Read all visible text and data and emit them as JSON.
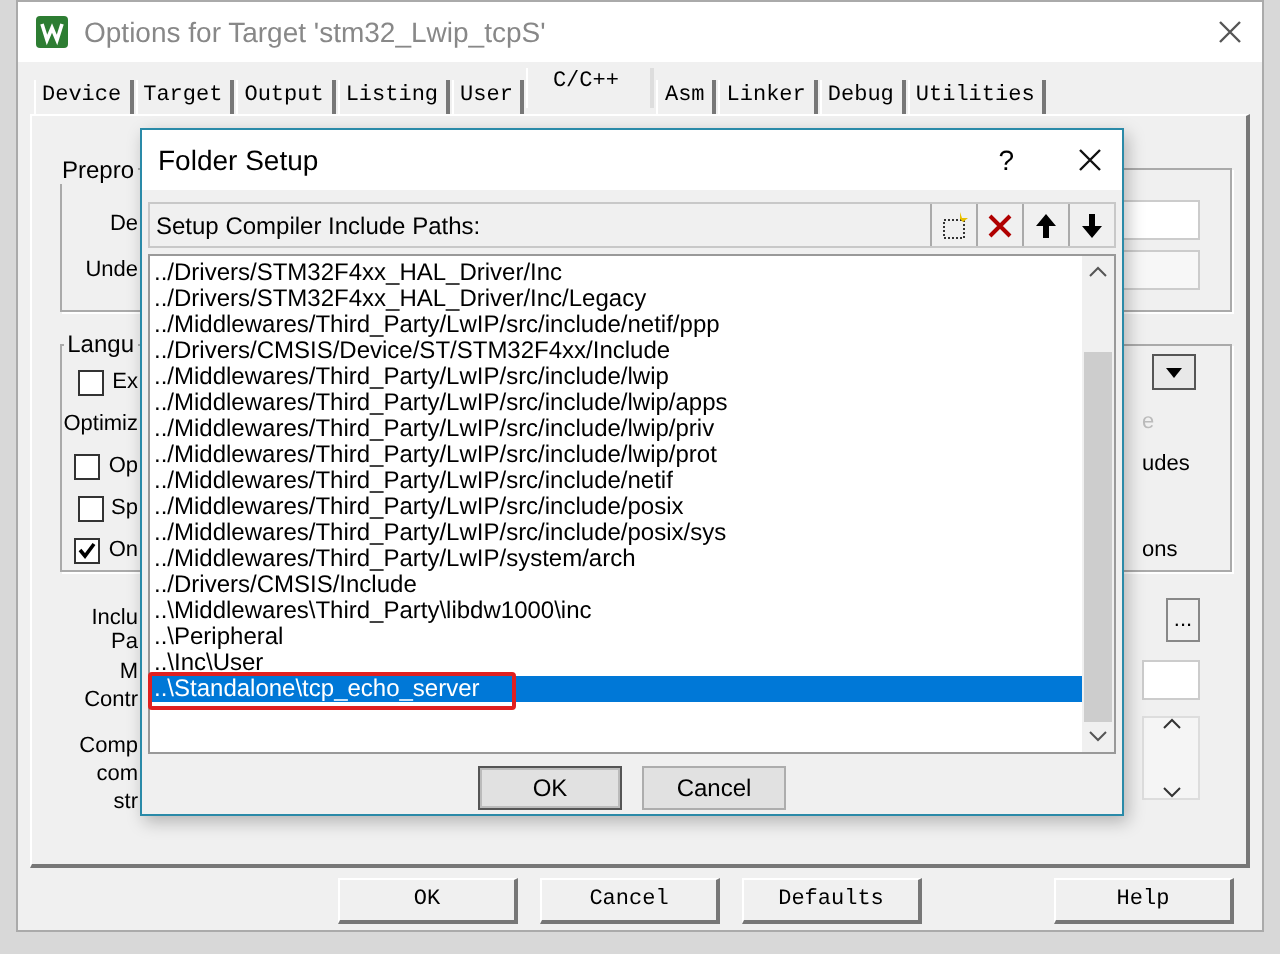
{
  "window": {
    "title": "Options for Target 'stm32_Lwip_tcpS'"
  },
  "tabs": [
    {
      "label": "Device",
      "selected": false
    },
    {
      "label": "Target",
      "selected": false
    },
    {
      "label": "Output",
      "selected": false
    },
    {
      "label": "Listing",
      "selected": false
    },
    {
      "label": "User",
      "selected": false
    },
    {
      "label": "C/C++",
      "selected": true
    },
    {
      "label": "Asm",
      "selected": false
    },
    {
      "label": "Linker",
      "selected": false
    },
    {
      "label": "Debug",
      "selected": false
    },
    {
      "label": "Utilities",
      "selected": false
    }
  ],
  "behind": [
    {
      "kind": "group",
      "text": "Prepro"
    },
    {
      "kind": "label",
      "text": "De"
    },
    {
      "kind": "label",
      "text": "Unde"
    },
    {
      "kind": "group",
      "text": "Langu"
    },
    {
      "kind": "checkbox",
      "text": "Ex",
      "checked": false
    },
    {
      "kind": "label",
      "text": "Optimiz"
    },
    {
      "kind": "checkbox",
      "text": "Op",
      "checked": false
    },
    {
      "kind": "checkbox",
      "text": "Sp",
      "checked": false
    },
    {
      "kind": "checkbox",
      "text": "On",
      "checked": true
    },
    {
      "kind": "label",
      "text": "Inclu"
    },
    {
      "kind": "label",
      "text": "Pa"
    },
    {
      "kind": "label",
      "text": "M"
    },
    {
      "kind": "label",
      "text": "Contr"
    },
    {
      "kind": "label",
      "text": "Comp"
    },
    {
      "kind": "label",
      "text": "com"
    },
    {
      "kind": "label",
      "text": "str"
    },
    {
      "kind": "label",
      "text": "e"
    },
    {
      "kind": "label",
      "text": "udes"
    },
    {
      "kind": "label",
      "text": "ons"
    },
    {
      "kind": "button",
      "text": "..."
    }
  ],
  "buttons": [
    "OK",
    "Cancel",
    "Defaults",
    "Help"
  ],
  "folder_setup": {
    "title": "Folder Setup",
    "help": "?",
    "header": "Setup Compiler Include Paths:",
    "paths": [
      {
        "text": "../Drivers/STM32F4xx_HAL_Driver/Inc",
        "selected": false,
        "marked": false
      },
      {
        "text": "../Drivers/STM32F4xx_HAL_Driver/Inc/Legacy",
        "selected": false,
        "marked": false
      },
      {
        "text": "../Middlewares/Third_Party/LwIP/src/include/netif/ppp",
        "selected": false,
        "marked": false
      },
      {
        "text": "../Drivers/CMSIS/Device/ST/STM32F4xx/Include",
        "selected": false,
        "marked": false
      },
      {
        "text": "../Middlewares/Third_Party/LwIP/src/include/lwip",
        "selected": false,
        "marked": false
      },
      {
        "text": "../Middlewares/Third_Party/LwIP/src/include/lwip/apps",
        "selected": false,
        "marked": false
      },
      {
        "text": "../Middlewares/Third_Party/LwIP/src/include/lwip/priv",
        "selected": false,
        "marked": false
      },
      {
        "text": "../Middlewares/Third_Party/LwIP/src/include/lwip/prot",
        "selected": false,
        "marked": false
      },
      {
        "text": "../Middlewares/Third_Party/LwIP/src/include/netif",
        "selected": false,
        "marked": false
      },
      {
        "text": "../Middlewares/Third_Party/LwIP/src/include/posix",
        "selected": false,
        "marked": false
      },
      {
        "text": "../Middlewares/Third_Party/LwIP/src/include/posix/sys",
        "selected": false,
        "marked": false
      },
      {
        "text": "../Middlewares/Third_Party/LwIP/system/arch",
        "selected": false,
        "marked": false
      },
      {
        "text": "../Drivers/CMSIS/Include",
        "selected": false,
        "marked": false
      },
      {
        "text": "..\\Middlewares\\Third_Party\\libdw1000\\inc",
        "selected": false,
        "marked": false
      },
      {
        "text": "..\\Peripheral",
        "selected": false,
        "marked": false
      },
      {
        "text": "..\\Inc\\User",
        "selected": false,
        "marked": false
      },
      {
        "text": "..\\Standalone\\tcp_echo_server",
        "selected": true,
        "marked": true
      }
    ],
    "buttons": [
      "OK",
      "Cancel"
    ]
  }
}
